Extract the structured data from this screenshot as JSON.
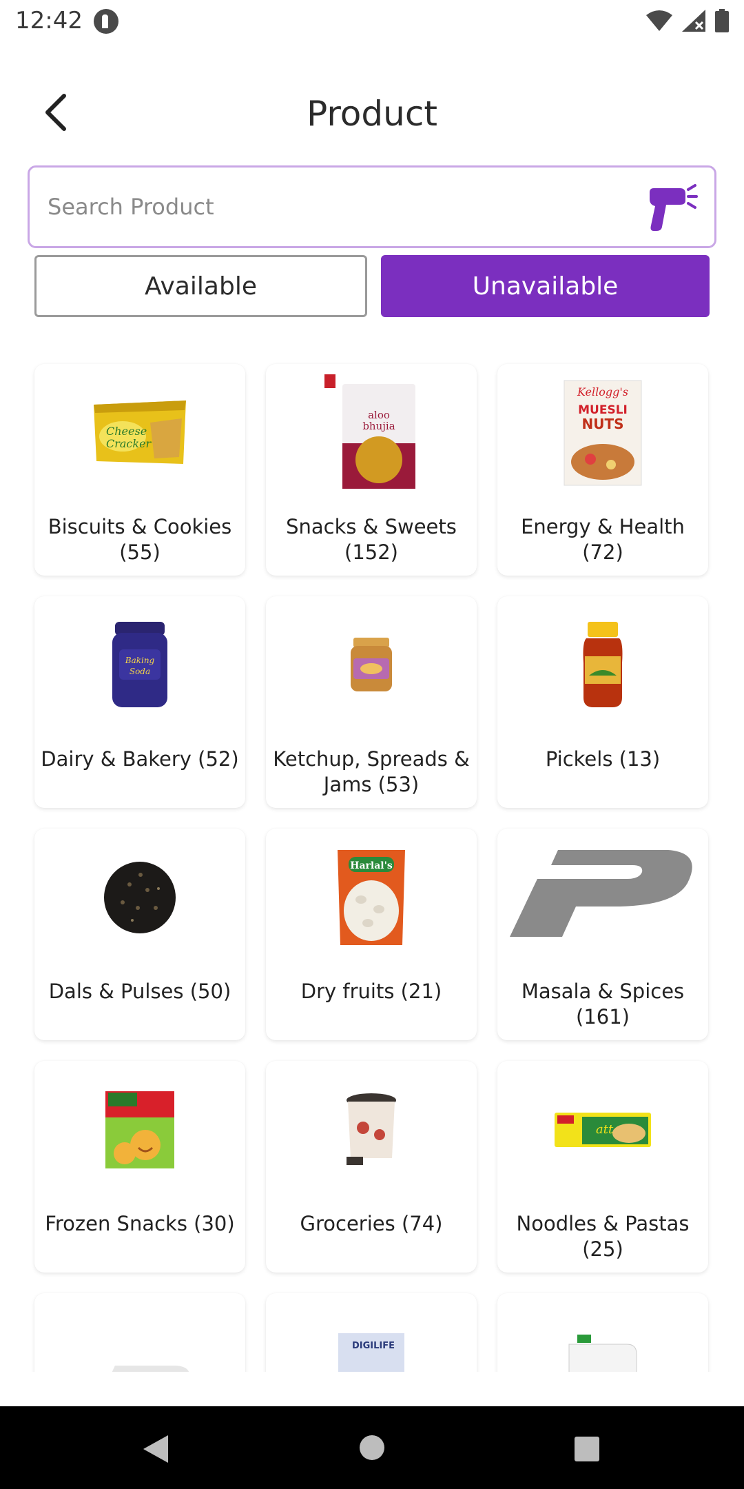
{
  "status_bar": {
    "time": "12:42"
  },
  "header": {
    "title": "Product"
  },
  "search": {
    "placeholder": "Search Product"
  },
  "toggle": {
    "available_label": "Available",
    "unavailable_label": "Unavailable",
    "selected": "Unavailable"
  },
  "colors": {
    "accent": "#7b2fbf",
    "search_border": "#c9a7e6",
    "nav_bar": "#000000"
  },
  "categories": [
    {
      "label": "Biscuits & Cookies (55)",
      "icon": "cheese-cracker-pack-image"
    },
    {
      "label": "Snacks & Sweets (152)",
      "icon": "aloo-bhujia-pack-image"
    },
    {
      "label": "Energy & Health (72)",
      "icon": "muesli-box-image"
    },
    {
      "label": "Dairy & Bakery (52)",
      "icon": "baking-soda-jar-image"
    },
    {
      "label": "Ketchup, Spreads & Jams (53)",
      "icon": "peanut-butter-jar-image"
    },
    {
      "label": "Pickels (13)",
      "icon": "pickle-jar-image"
    },
    {
      "label": "Dals & Pulses (50)",
      "icon": "black-seeds-bowl-image"
    },
    {
      "label": "Dry fruits (21)",
      "icon": "harlals-beans-pack-image"
    },
    {
      "label": "Masala & Spices (161)",
      "icon": "placeholder-p-logo"
    },
    {
      "label": "Frozen Snacks (30)",
      "icon": "frozen-smiles-pack-image"
    },
    {
      "label": "Groceries (74)",
      "icon": "dustbin-image"
    },
    {
      "label": "Noodles & Pastas (25)",
      "icon": "atta-noodles-pack-image"
    },
    {
      "label": "",
      "icon": "placeholder-p-logo"
    },
    {
      "label": "",
      "icon": "digilife-mask-pack-image"
    },
    {
      "label": "",
      "icon": "detergent-can-image"
    }
  ]
}
